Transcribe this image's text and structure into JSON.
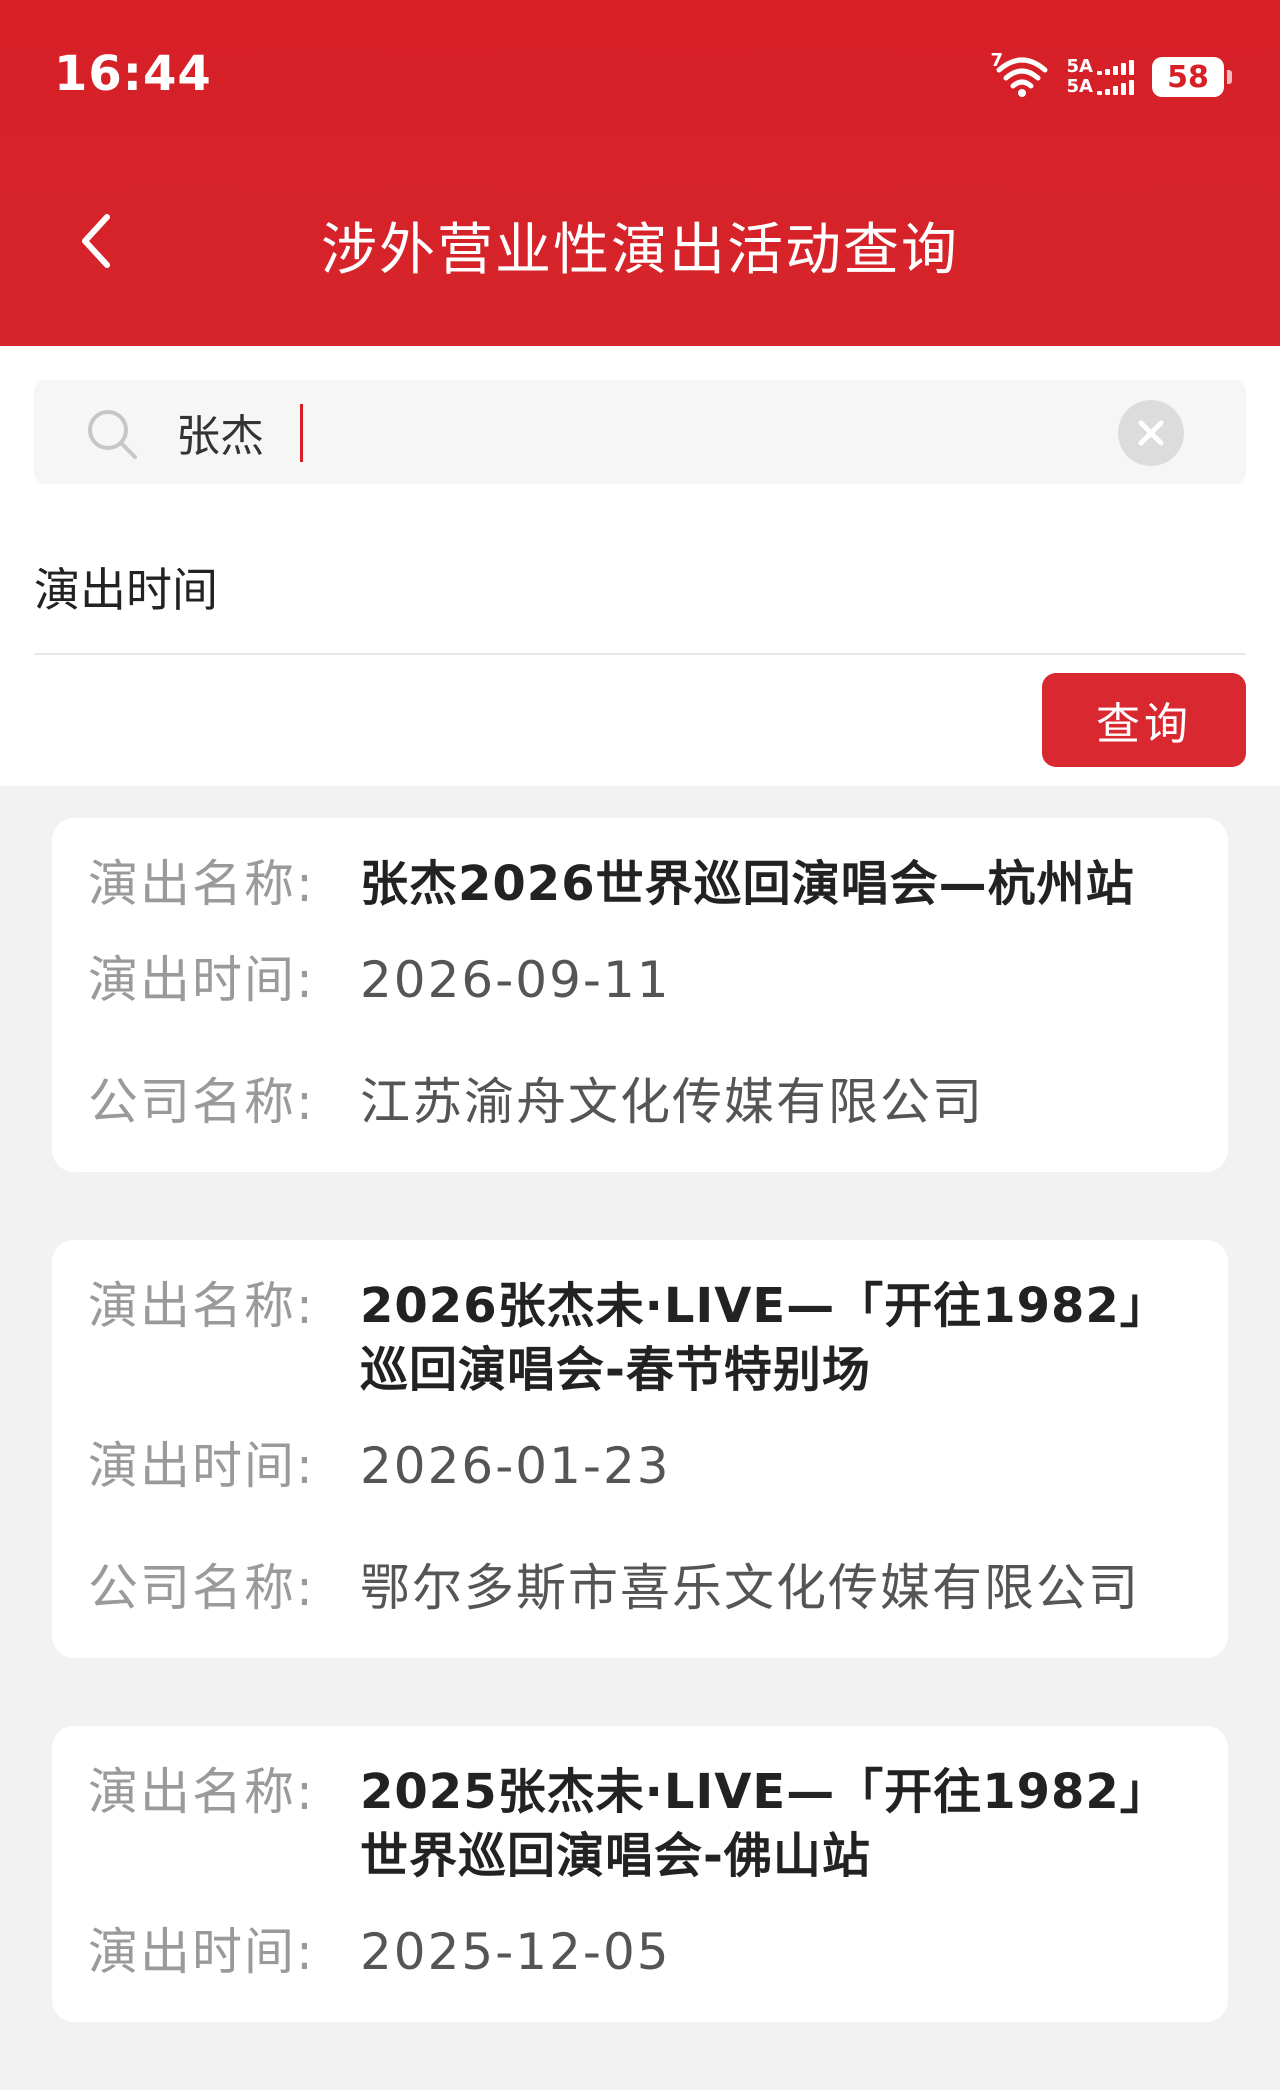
{
  "status_bar": {
    "time": "16:44",
    "wifi_badge": "7",
    "network_1": "5A",
    "network_2": "5A",
    "battery": "58"
  },
  "header": {
    "title": "涉外营业性演出活动查询",
    "back_icon": "chevron-left-icon"
  },
  "search": {
    "value": "张杰",
    "placeholder": "",
    "icon": "search-icon",
    "clear_icon": "clear-icon"
  },
  "filter": {
    "time_label": "演出时间",
    "query_button": "查询"
  },
  "labels": {
    "name": "演出名称:",
    "time": "演出时间:",
    "company": "公司名称:"
  },
  "results": [
    {
      "name": "张杰2026世界巡回演唱会—杭州站",
      "time": "2026-09-11",
      "company": "江苏渝舟文化传媒有限公司"
    },
    {
      "name": "2026张杰未·LIVE—「开往1982」巡回演唱会-春节特别场",
      "time": "2026-01-23",
      "company": "鄂尔多斯市喜乐文化传媒有限公司"
    },
    {
      "name": "2025张杰未·LIVE—「开往1982」世界巡回演唱会-佛山站",
      "time": "2025-12-05",
      "company": ""
    }
  ],
  "colors": {
    "brand_red": "#d71f26",
    "button_red": "#d9282f",
    "label_gray": "#9a9a9a"
  }
}
